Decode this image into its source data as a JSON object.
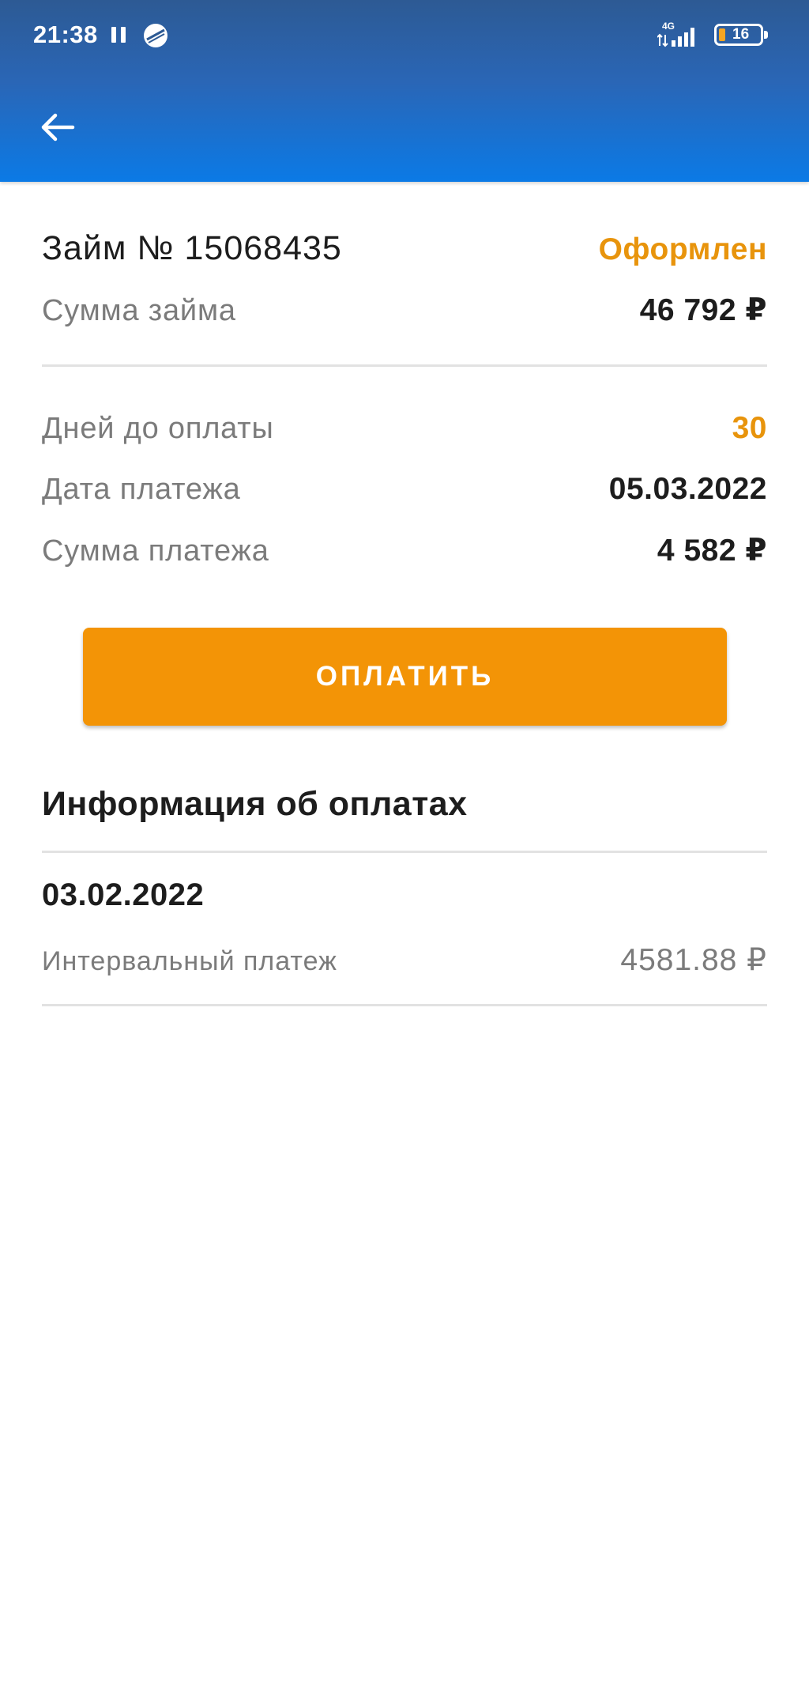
{
  "status_bar": {
    "time": "21:38",
    "network": "4G",
    "battery_level": "16",
    "battery_fraction": 0.16
  },
  "header": {
    "back_icon": "arrow-left-icon"
  },
  "loan": {
    "title": "Займ № 15068435",
    "status": "Оформлен",
    "amount_label": "Сумма займа",
    "amount_value": "46 792 ₽"
  },
  "schedule": {
    "days_label": "Дней до оплаты",
    "days_value": "30",
    "date_label": "Дата платежа",
    "date_value": "05.03.2022",
    "payment_label": "Сумма платежа",
    "payment_value": "4 582 ₽"
  },
  "pay_button": {
    "label": "ОПЛАТИТЬ"
  },
  "payments_info": {
    "title": "Информация об оплатах",
    "items": [
      {
        "date": "03.02.2022",
        "type": "Интервальный платеж",
        "amount": "4581.88 ₽"
      }
    ]
  },
  "colors": {
    "accent": "#e8940c",
    "button": "#f39406",
    "header_top": "#2d5a94",
    "header_bottom": "#0b7ae6"
  }
}
